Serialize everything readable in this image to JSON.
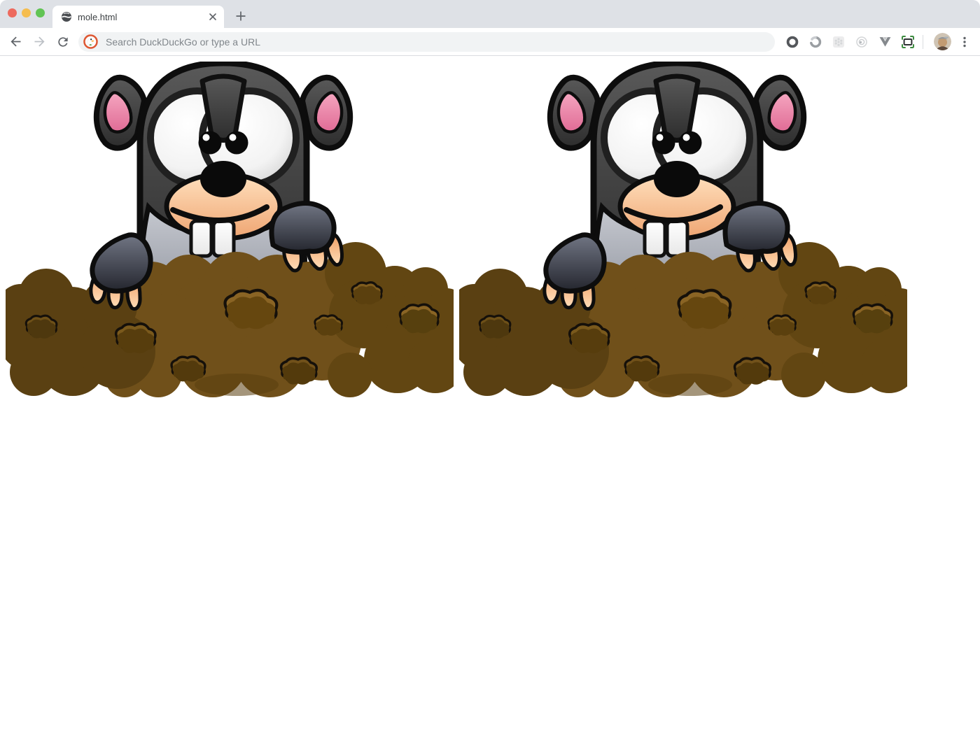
{
  "window": {
    "traffic_lights": {
      "close_color": "#ED6A5E",
      "minimize_color": "#F5BD4F",
      "zoom_color": "#61C454"
    }
  },
  "tab_strip": {
    "background": "#DEE1E6",
    "tabs": [
      {
        "title": "mole.html",
        "favicon": "globe-icon",
        "active": true
      }
    ],
    "new_tab_button": "new-tab-plus-icon"
  },
  "toolbar": {
    "back_icon": "back-arrow",
    "forward_icon": "forward-arrow-disabled",
    "reload_icon": "reload-arrow",
    "omnibox": {
      "placeholder": "Search DuckDuckGo or type a URL",
      "search_engine_icon": "duckduckgo-icon",
      "background": "#F1F3F4"
    },
    "extensions": [
      {
        "name": "dark-ring-extension-icon"
      },
      {
        "name": "gray-swirl-extension-icon"
      },
      {
        "name": "faded-grid-extension-icon"
      },
      {
        "name": "faded-target-extension-icon"
      },
      {
        "name": "v-shape-extension-icon"
      },
      {
        "name": "screen-capture-extension-icon",
        "accent": "#3D8B40"
      }
    ],
    "profile": {
      "name": "profile-avatar"
    },
    "menu": {
      "name": "kebab-menu-icon"
    }
  },
  "content": {
    "background": "#FFFFFF",
    "images": [
      {
        "name": "cartoon-mole-in-dirt-mound",
        "position": "left"
      },
      {
        "name": "cartoon-mole-in-dirt-mound",
        "position": "right"
      }
    ],
    "palette": {
      "mole_fur": "#3d3d3d",
      "ear_pink": "#ee86aa",
      "muzzle": "#ffd8b2",
      "body_gray": "#a7abb5",
      "claw": "#ffc796",
      "dirt_main": "#70501A",
      "dirt_dark": "#5A4012",
      "dirt_right": "#624612"
    }
  }
}
